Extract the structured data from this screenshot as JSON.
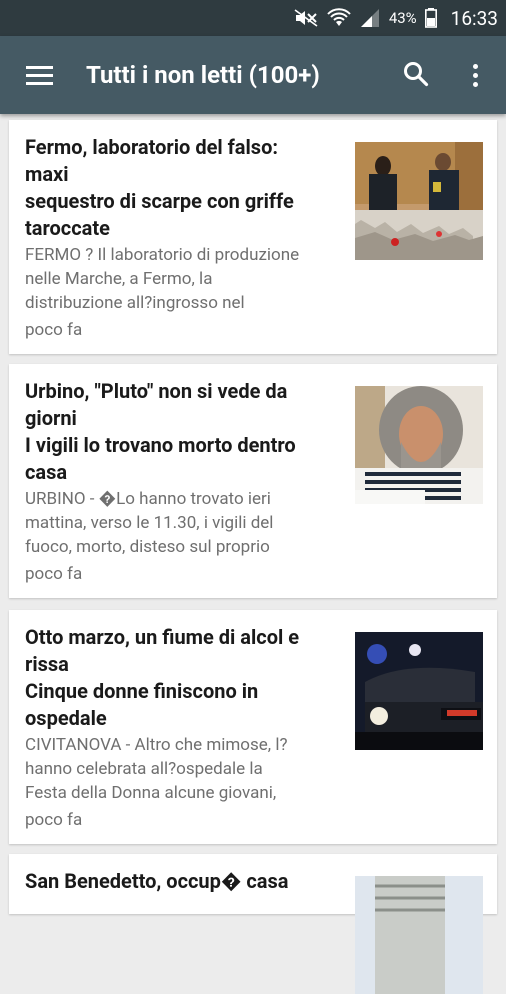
{
  "status_bar": {
    "battery": "43%",
    "time": "16:33"
  },
  "app_bar": {
    "title": "Tutti i non letti (100+)"
  },
  "articles": [
    {
      "headline_lines": [
        " Fermo, laboratorio del falso:",
        "maxi",
        "sequestro di scarpe con griffe",
        "taroccate"
      ],
      "summary_lines": [
        "FERMO ? Il laboratorio di produzione",
        "nelle Marche, a Fermo, la",
        "distribuzione all?ingrosso nel"
      ],
      "time": "poco fa"
    },
    {
      "headline_lines": [
        " Urbino, \"Pluto\" non si vede da",
        "giorni",
        "I vigili lo trovano morto dentro",
        "casa"
      ],
      "summary_lines": [
        "URBINO - �Lo hanno trovato ieri",
        "mattina, verso le 11.30, i vigili del",
        "fuoco, morto, disteso sul proprio"
      ],
      "time": "poco fa"
    },
    {
      "headline_lines": [
        " Otto marzo, un fiume di alcol e",
        "rissa",
        "Cinque donne finiscono in",
        "ospedale"
      ],
      "summary_lines": [
        "CIVITANOVA - Altro che mimose, l?",
        "hanno celebrata all?ospedale la",
        "Festa della Donna alcune giovani,"
      ],
      "time": "poco fa"
    },
    {
      "headline_lines": [
        " San Benedetto, occup� casa"
      ]
    }
  ]
}
